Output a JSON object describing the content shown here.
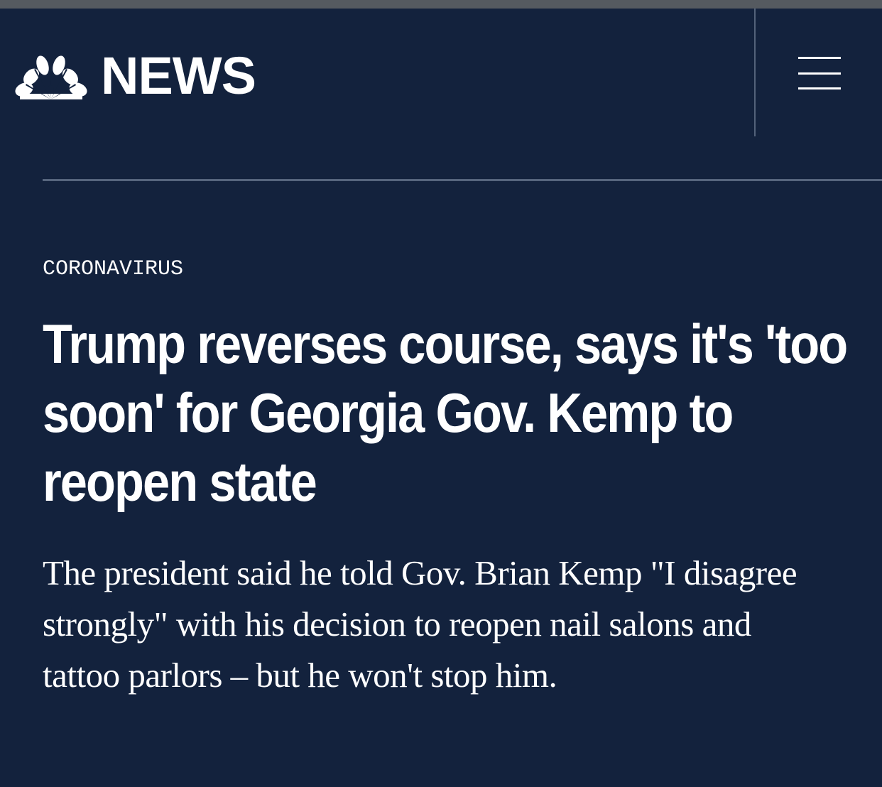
{
  "header": {
    "logo_text": "NEWS",
    "logo_icon": "nbc-peacock-icon",
    "menu_icon": "hamburger-menu-icon"
  },
  "article": {
    "section": "CORONAVIRUS",
    "headline": "Trump reverses course, says it's 'too soon' for Georgia Gov. Kemp to reopen state",
    "dek": "The president said he told Gov. Brian Kemp \"I disagree strongly\" with his decision to reopen nail salons and tattoo parlors – but he won't stop him."
  },
  "colors": {
    "background": "#13223d",
    "top_strip": "#555a60",
    "divider": "#56657d",
    "text": "#ffffff"
  }
}
